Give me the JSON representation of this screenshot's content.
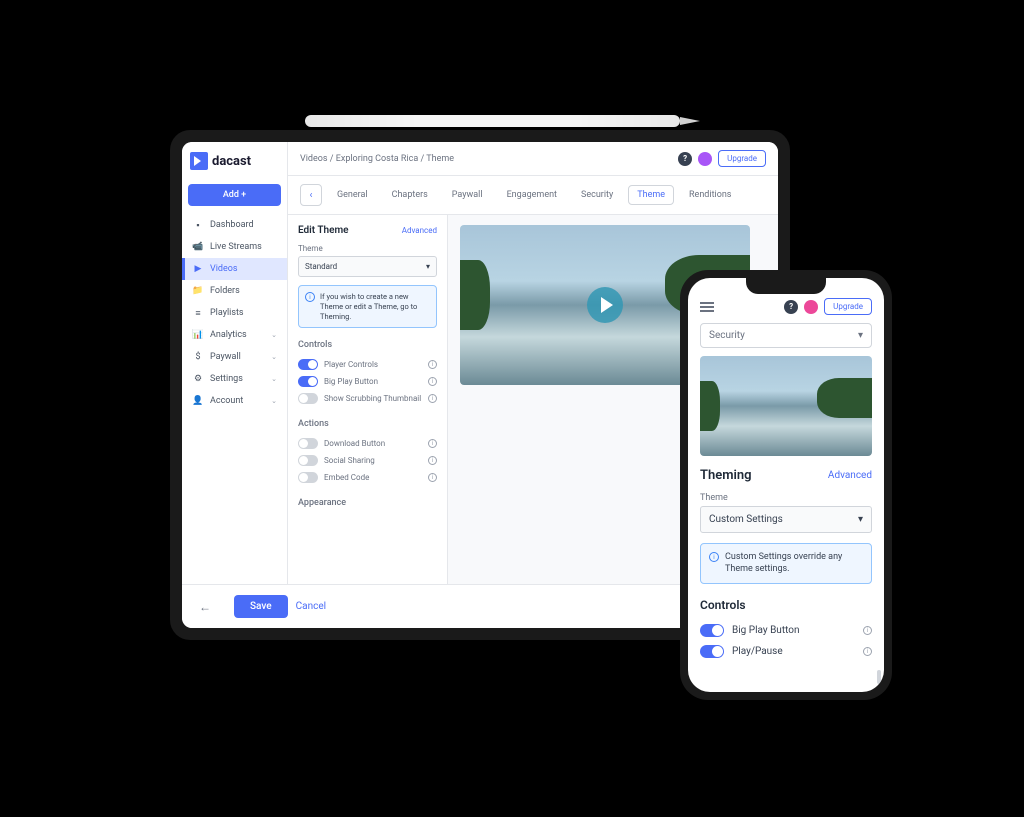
{
  "brand": {
    "name": "dacast"
  },
  "sidebar": {
    "add": "Add +",
    "items": [
      {
        "label": "Dashboard",
        "icon": "▪"
      },
      {
        "label": "Live Streams",
        "icon": "📹"
      },
      {
        "label": "Videos",
        "icon": "▶"
      },
      {
        "label": "Folders",
        "icon": "📁"
      },
      {
        "label": "Playlists",
        "icon": "≡"
      },
      {
        "label": "Analytics",
        "icon": "📊",
        "chev": true
      },
      {
        "label": "Paywall",
        "icon": "$",
        "chev": true
      },
      {
        "label": "Settings",
        "icon": "⚙",
        "chev": true
      },
      {
        "label": "Account",
        "icon": "👤",
        "chev": true
      }
    ]
  },
  "breadcrumb": {
    "a": "Videos",
    "b": "Exploring Costa Rica",
    "c": "Theme",
    "sep": " / "
  },
  "header": {
    "upgrade": "Upgrade"
  },
  "tabs": [
    "General",
    "Chapters",
    "Paywall",
    "Engagement",
    "Security",
    "Theme",
    "Renditions"
  ],
  "panel": {
    "title": "Edit Theme",
    "advanced": "Advanced",
    "themeLabel": "Theme",
    "themeValue": "Standard",
    "info": "If you wish to create a new Theme or edit a Theme, go to Theming.",
    "controlsLabel": "Controls",
    "controls": [
      {
        "label": "Player Controls",
        "on": true
      },
      {
        "label": "Big Play Button",
        "on": true
      },
      {
        "label": "Show Scrubbing Thumbnail",
        "on": false
      }
    ],
    "actionsLabel": "Actions",
    "actions": [
      {
        "label": "Download Button",
        "on": false
      },
      {
        "label": "Social Sharing",
        "on": false
      },
      {
        "label": "Embed Code",
        "on": false
      }
    ],
    "appearanceLabel": "Appearance"
  },
  "footer": {
    "save": "Save",
    "cancel": "Cancel"
  },
  "phone": {
    "upgrade": "Upgrade",
    "selectValue": "Security",
    "sectionTitle": "Theming",
    "advanced": "Advanced",
    "themeLabel": "Theme",
    "themeValue": "Custom Settings",
    "info": "Custom Settings override any Theme settings.",
    "controlsLabel": "Controls",
    "controls": [
      {
        "label": "Big Play Button"
      },
      {
        "label": "Play/Pause"
      }
    ]
  }
}
